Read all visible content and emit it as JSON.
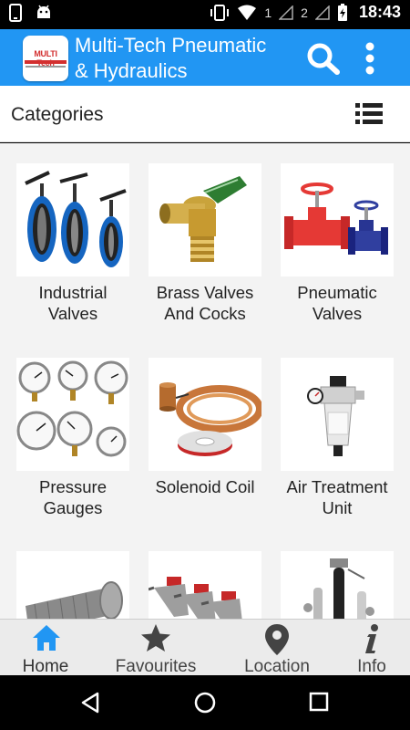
{
  "status_bar": {
    "sim1": "1",
    "sim2": "2",
    "time": "18:43"
  },
  "app_bar": {
    "logo_text": "MULTI Tech",
    "title_line1": "Multi-Tech Pneumatic",
    "title_line2": "& Hydraulics"
  },
  "section": {
    "title": "Categories"
  },
  "categories": [
    {
      "label_line1": "Industrial",
      "label_line2": "Valves",
      "icon": "butterfly-valves-image"
    },
    {
      "label_line1": "Brass Valves",
      "label_line2": "And Cocks",
      "icon": "brass-cock-image"
    },
    {
      "label_line1": "Pneumatic",
      "label_line2": "Valves",
      "icon": "diaphragm-valves-image"
    },
    {
      "label_line1": "Pressure",
      "label_line2": "Gauges",
      "icon": "pressure-gauges-image"
    },
    {
      "label_line1": "Solenoid Coil",
      "label_line2": "",
      "icon": "copper-coil-image"
    },
    {
      "label_line1": "Air Treatment",
      "label_line2": "Unit",
      "icon": "frl-unit-image"
    }
  ],
  "bottom_nav": [
    {
      "label": "Home",
      "icon": "home-icon",
      "active": true
    },
    {
      "label": "Favourites",
      "icon": "star-icon",
      "active": false
    },
    {
      "label": "Location",
      "icon": "location-pin-icon",
      "active": false
    },
    {
      "label": "Info",
      "icon": "info-icon",
      "active": false
    }
  ],
  "colors": {
    "primary": "#2196f3",
    "active_nav": "#2196f3",
    "inactive_nav": "#444444"
  }
}
